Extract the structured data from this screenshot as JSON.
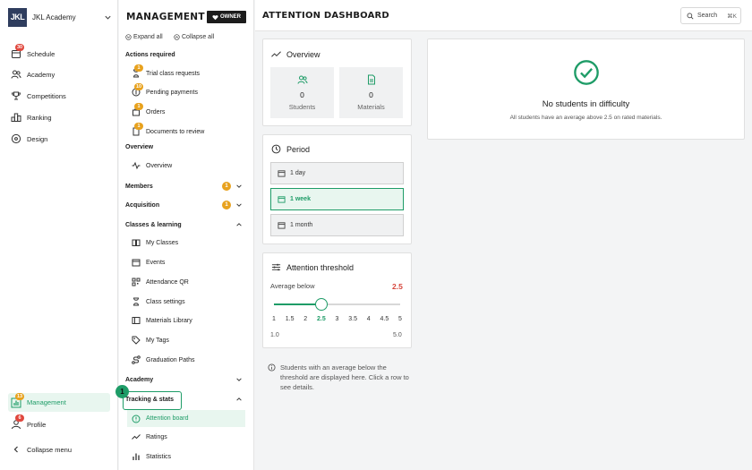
{
  "brand": {
    "logo_text": "JKL",
    "name": "JKL Academy"
  },
  "nav": {
    "schedule": {
      "label": "Schedule",
      "badge": "30"
    },
    "academy": {
      "label": "Academy"
    },
    "competitions": {
      "label": "Competitions"
    },
    "ranking": {
      "label": "Ranking"
    },
    "design": {
      "label": "Design"
    },
    "management": {
      "label": "Management",
      "badge": "13"
    },
    "profile": {
      "label": "Profile",
      "badge": "6"
    },
    "collapse": {
      "label": "Collapse menu"
    }
  },
  "management": {
    "title": "MANAGEMENT",
    "role": "OWNER",
    "expand_all": "Expand all",
    "collapse_all": "Collapse all",
    "actions_required": {
      "label": "Actions required",
      "items": [
        {
          "label": "Trial class requests",
          "badge": "1"
        },
        {
          "label": "Pending payments",
          "badge": "10"
        },
        {
          "label": "Orders",
          "badge": "1"
        },
        {
          "label": "Documents to review",
          "badge": "1"
        }
      ]
    },
    "overview": {
      "label": "Overview",
      "item": "Overview"
    },
    "members": {
      "label": "Members",
      "badge": "1"
    },
    "acquisition": {
      "label": "Acquisition",
      "badge": "1"
    },
    "classes_learning": {
      "label": "Classes & learning",
      "items": [
        "My Classes",
        "Events",
        "Attendance QR",
        "Class settings",
        "Materials Library",
        "My Tags",
        "Graduation Paths"
      ]
    },
    "academy": {
      "label": "Academy"
    },
    "tracking": {
      "label": "Tracking & stats",
      "step": "1",
      "items": [
        "Attention board",
        "Ratings",
        "Statistics"
      ]
    }
  },
  "header": {
    "title": "ATTENTION DASHBOARD",
    "search_label": "Search",
    "search_shortcut": "⌘K"
  },
  "overview_card": {
    "title": "Overview",
    "stats": [
      {
        "value": "0",
        "label": "Students"
      },
      {
        "value": "0",
        "label": "Materials"
      }
    ]
  },
  "period_card": {
    "title": "Period",
    "options": [
      "1 day",
      "1 week",
      "1 month"
    ],
    "selected": "1 week"
  },
  "threshold_card": {
    "title": "Attention threshold",
    "label": "Average below",
    "value": "2.5",
    "value_num": 2.5,
    "min_value": 1.0,
    "max_value": 5.0,
    "ticks": [
      "1",
      "1.5",
      "2",
      "2.5",
      "3",
      "3.5",
      "4",
      "4.5",
      "5"
    ],
    "min_label": "1.0",
    "max_label": "5.0"
  },
  "info_text": "Students with an average below the threshold are displayed here. Click a row to see details.",
  "empty_state": {
    "title": "No students in difficulty",
    "subtitle": "All students have an average above 2.5 on rated materials."
  },
  "colors": {
    "accent": "#1e9c67",
    "danger": "#d6453b",
    "badge_red": "#e0473d",
    "badge_orange": "#e8a21e",
    "brand": "#2f3d5e"
  }
}
